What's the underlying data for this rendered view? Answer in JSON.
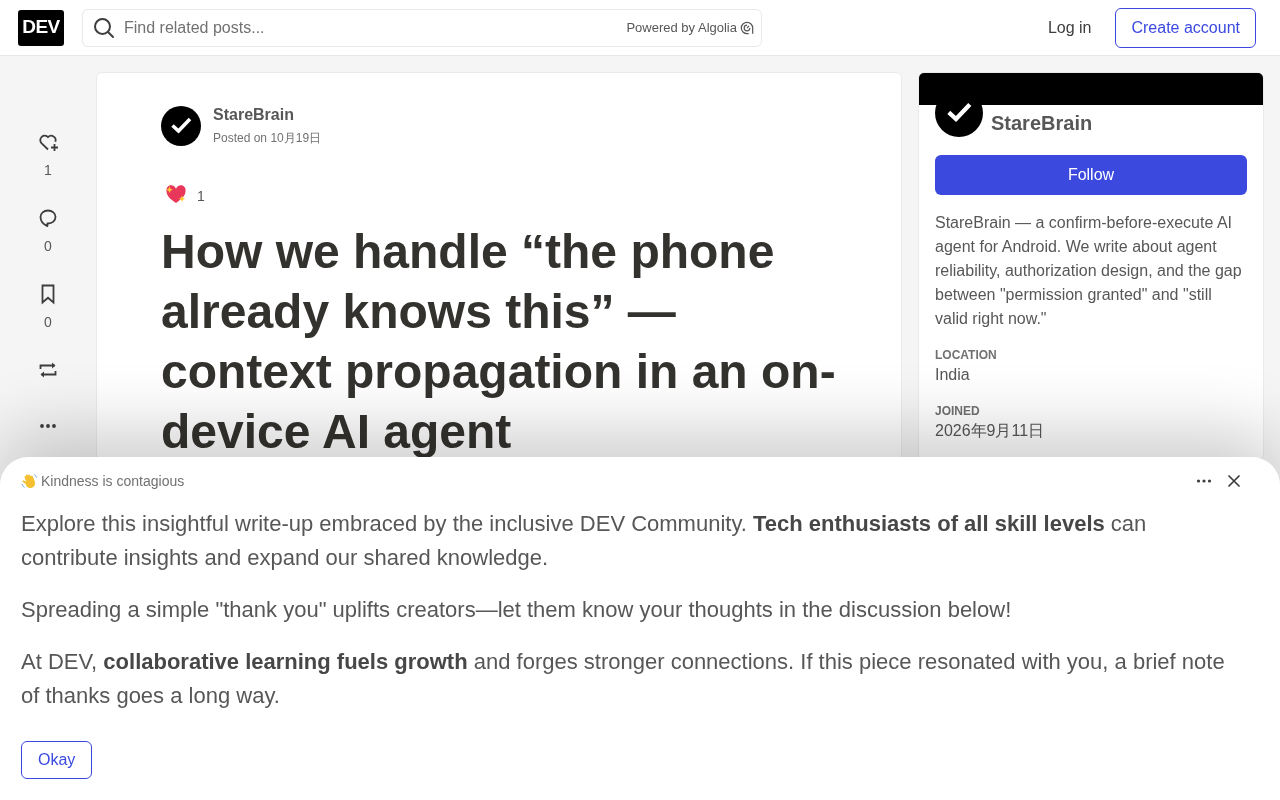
{
  "header": {
    "logo": "DEV",
    "search": {
      "placeholder": "Find related posts...",
      "attribution": "Powered by Algolia"
    },
    "actions": [
      {
        "kind": "link",
        "label": "Log in"
      },
      {
        "kind": "outline",
        "label": "Create account"
      }
    ]
  },
  "reaction_bar": [
    {
      "kind": "like",
      "count": "1"
    },
    {
      "kind": "comment",
      "count": "0"
    },
    {
      "kind": "bookmark",
      "count": "0"
    },
    {
      "kind": "repost"
    },
    {
      "kind": "more"
    }
  ],
  "article": {
    "author": "StareBrain",
    "posted": "Posted on 10月19日",
    "reactions": [
      {
        "kind": "sparkle-heart",
        "count": "1"
      }
    ],
    "title": "How we handle “the phone already knows this” — context propagation in an on-device AI agent"
  },
  "profile_card": {
    "name": "StareBrain",
    "follow_button": "Follow",
    "bio": "StareBrain — a confirm-before-execute AI agent for Android. We write about agent reliability, authorization design, and the gap between \"permission granted\" and \"still valid right now.\"",
    "details": [
      {
        "label": "LOCATION",
        "value": "India"
      },
      {
        "label": "JOINED",
        "value": "2026年9月11日"
      }
    ]
  },
  "notice_sheet": {
    "title": "Kindness is contagious",
    "paragraphs": [
      "Explore this insightful write-up embraced by the inclusive DEV Community. **Tech enthusiasts of all skill levels** can contribute insights and expand our shared knowledge.",
      "Spreading a simple \"thank you\" uplifts creators—let them know your thoughts in the discussion below!",
      "At DEV, **collaborative learning fuels growth** and forges stronger connections. If this piece resonated with you, a brief note of thanks goes a long way."
    ],
    "button": "Okay"
  }
}
